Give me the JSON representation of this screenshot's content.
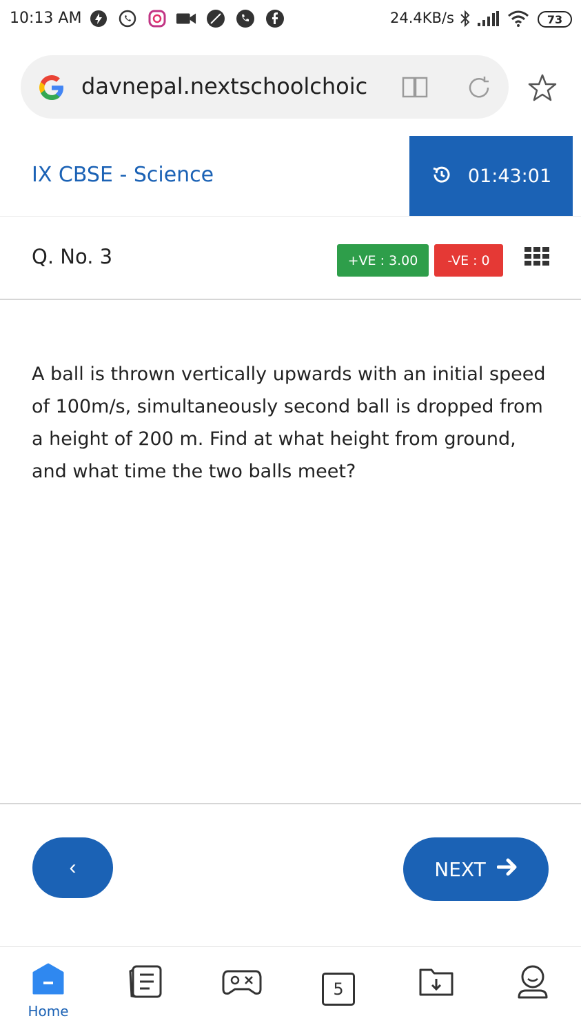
{
  "status_bar": {
    "time": "10:13 AM",
    "network_speed": "24.4KB/s",
    "battery": "73",
    "icons": [
      "bolt-icon",
      "whatsapp-icon",
      "instagram-icon",
      "video-camera-icon",
      "leaf-icon",
      "phone-icon",
      "facebook-icon",
      "bluetooth-icon",
      "signal-icon",
      "wifi-icon"
    ]
  },
  "browser": {
    "url": "davnepal.nextschoolchoic",
    "icons": [
      "google-icon",
      "reader-mode-icon",
      "reload-icon",
      "bookmark-star-icon"
    ]
  },
  "header": {
    "course_title": "IX CBSE - Science",
    "timer": "01:43:01",
    "timer_icon": "history-icon",
    "timer_bg": "#1b62b5"
  },
  "question": {
    "number_label": "Q. No. 3",
    "positive_marks": "+VE : 3.00",
    "negative_marks": "-VE : 0",
    "text": "A ball is thrown vertically upwards with an initial speed of 100m/s, simultaneously second ball is dropped from a height of 200 m. Find at what height from ground, and what time the two balls meet?",
    "positive_color": "#2e9e4a",
    "negative_color": "#e53935"
  },
  "navigation": {
    "prev_label": "‹",
    "next_label": "NEXT",
    "accent": "#1b62b5"
  },
  "bottom_nav": {
    "items": [
      {
        "label": "Home",
        "icon": "home-icon"
      },
      {
        "label": "",
        "icon": "notes-icon"
      },
      {
        "label": "",
        "icon": "gamepad-icon"
      },
      {
        "label": "5",
        "icon": "calendar-icon"
      },
      {
        "label": "",
        "icon": "download-folder-icon"
      },
      {
        "label": "",
        "icon": "profile-icon"
      }
    ]
  }
}
